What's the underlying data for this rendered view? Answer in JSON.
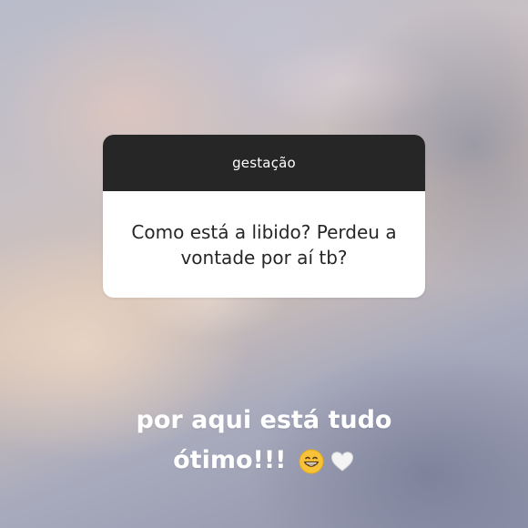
{
  "question_sticker": {
    "header_label": "gestação",
    "question_text": "Como está a libido? Perdeu a vontade por aí tb?"
  },
  "caption": {
    "line1": "por aqui está tudo",
    "line2": "ótimo!!!",
    "emoji": [
      "grinning-face-icon",
      "white-heart-icon"
    ]
  },
  "colors": {
    "sticker_header_bg": "#262626",
    "sticker_body_bg": "#ffffff",
    "caption_text": "#ffffff"
  }
}
